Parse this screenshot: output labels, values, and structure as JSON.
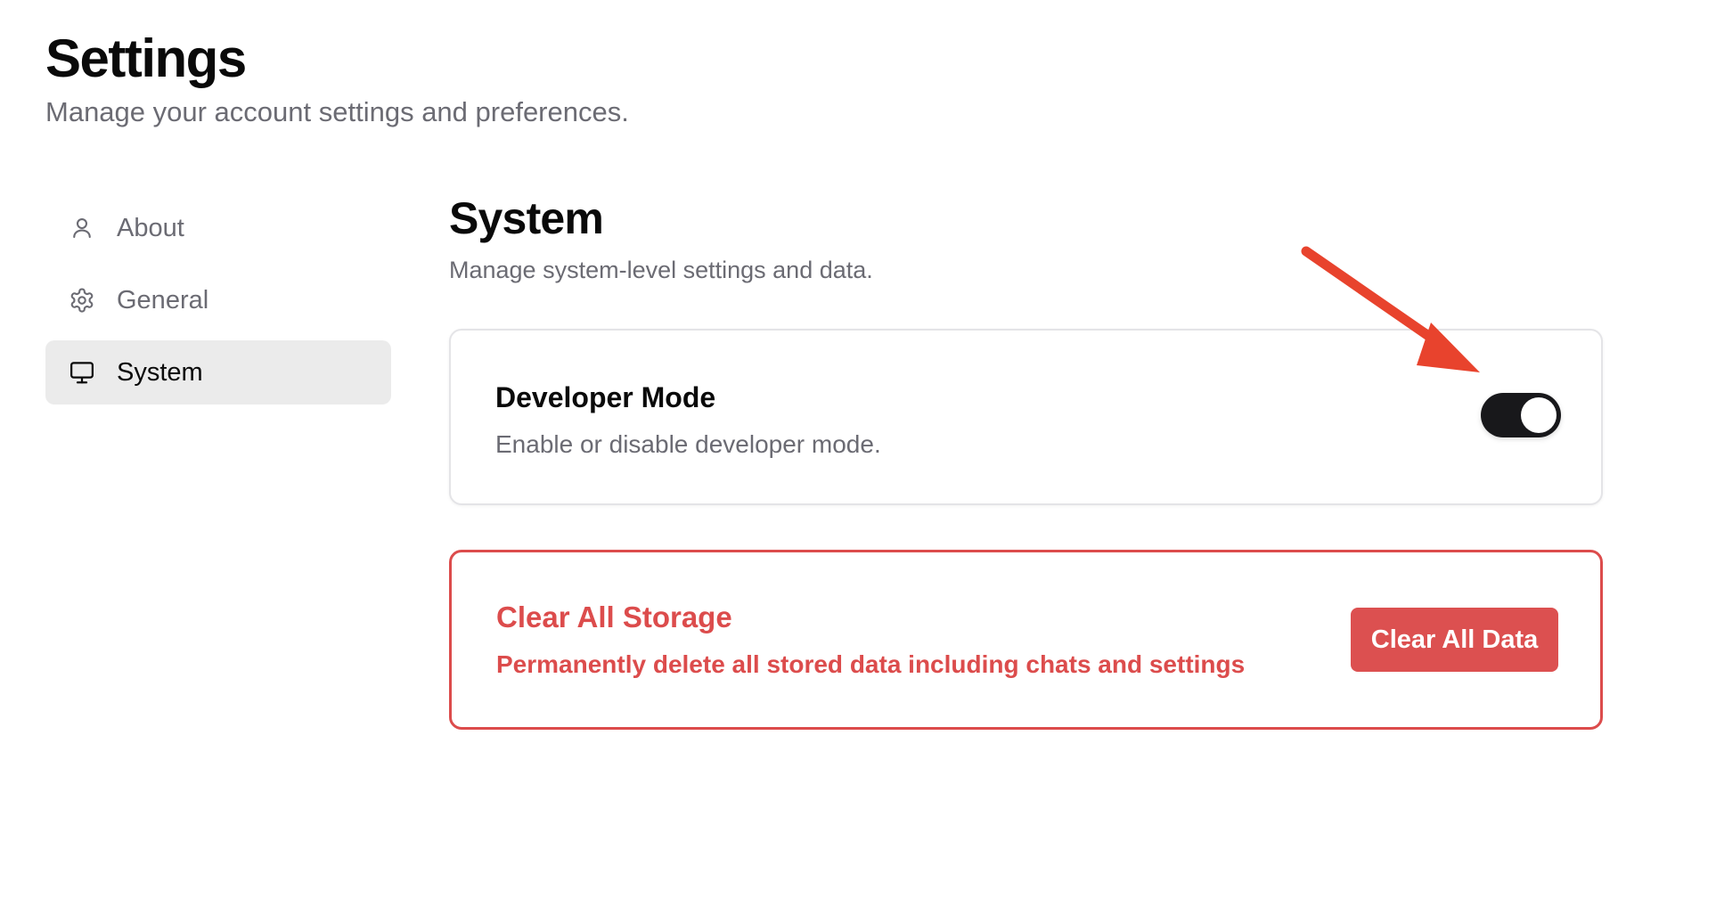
{
  "header": {
    "title": "Settings",
    "subtitle": "Manage your account settings and preferences."
  },
  "sidebar": {
    "items": [
      {
        "label": "About",
        "icon": "user-icon",
        "active": false
      },
      {
        "label": "General",
        "icon": "gear-icon",
        "active": false
      },
      {
        "label": "System",
        "icon": "monitor-icon",
        "active": true
      }
    ]
  },
  "section": {
    "title": "System",
    "subtitle": "Manage system-level settings and data."
  },
  "developer_mode": {
    "title": "Developer Mode",
    "description": "Enable or disable developer mode.",
    "enabled": true
  },
  "danger_zone": {
    "title": "Clear All Storage",
    "description": "Permanently delete all stored data including chats and settings",
    "button_label": "Clear All Data"
  },
  "colors": {
    "danger": "#dc4c4c",
    "toggle_on": "#18181b",
    "active_nav_bg": "#ebebeb",
    "annotation_arrow": "#e8432d"
  },
  "annotation": {
    "icon": "red-arrow-annotation",
    "target": "developer-mode-toggle"
  }
}
